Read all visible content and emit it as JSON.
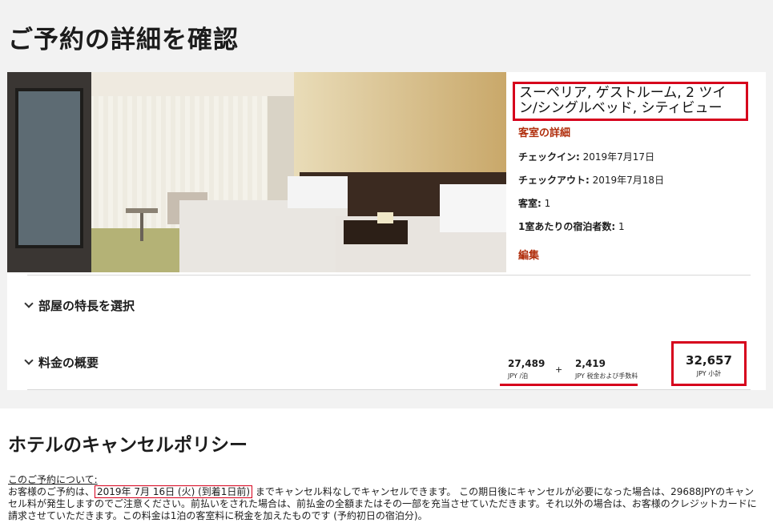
{
  "page_title": "ご予約の詳細を確認",
  "room": {
    "name": "スーペリア, ゲストルーム, 2 ツイン/シングルベッド, シティビュー",
    "details_link": "客室の詳細",
    "checkin_label": "チェックイン:",
    "checkin_value": " 2019年7月17日",
    "checkout_label": "チェックアウト:",
    "checkout_value": " 2019年7月18日",
    "rooms_label": "客室:",
    "rooms_value": " 1",
    "guests_label": "1室あたりの宿泊者数:",
    "guests_value": " 1",
    "edit_link": "編集"
  },
  "sections": {
    "features": "部屋の特長を選択",
    "summary": "料金の概要"
  },
  "price": {
    "nightly_value": "27,489",
    "nightly_unit": "JPY /泊",
    "plus": "+",
    "tax_value": "2,419",
    "tax_unit": "JPY 税金および手数料",
    "total_value": "32,657",
    "total_unit": "JPY 小計"
  },
  "cancellation": {
    "title": "ホテルのキャンセルポリシー",
    "about_label": "このご予約について:",
    "text_1": "お客様のご予約は、",
    "deadline": "2019年 7月 16日 (火) (到着1日前)",
    "text_2": " までキャンセル料なしでキャンセルできます。 この期日後にキャンセルが必要になった場合は、29688JPYのキャンセル料が発生しますのでご注意ください。前払いをされた場合は、前払金の全額またはその一部を充当させていただきます。それ以外の場合は、お客様のクレジットカードに請求させていただきます。この料金は1泊の客室料に税金を加えたものです (予約初日の宿泊分)。"
  },
  "colors": {
    "accent_red": "#d6001c",
    "link": "#b02d0b"
  }
}
